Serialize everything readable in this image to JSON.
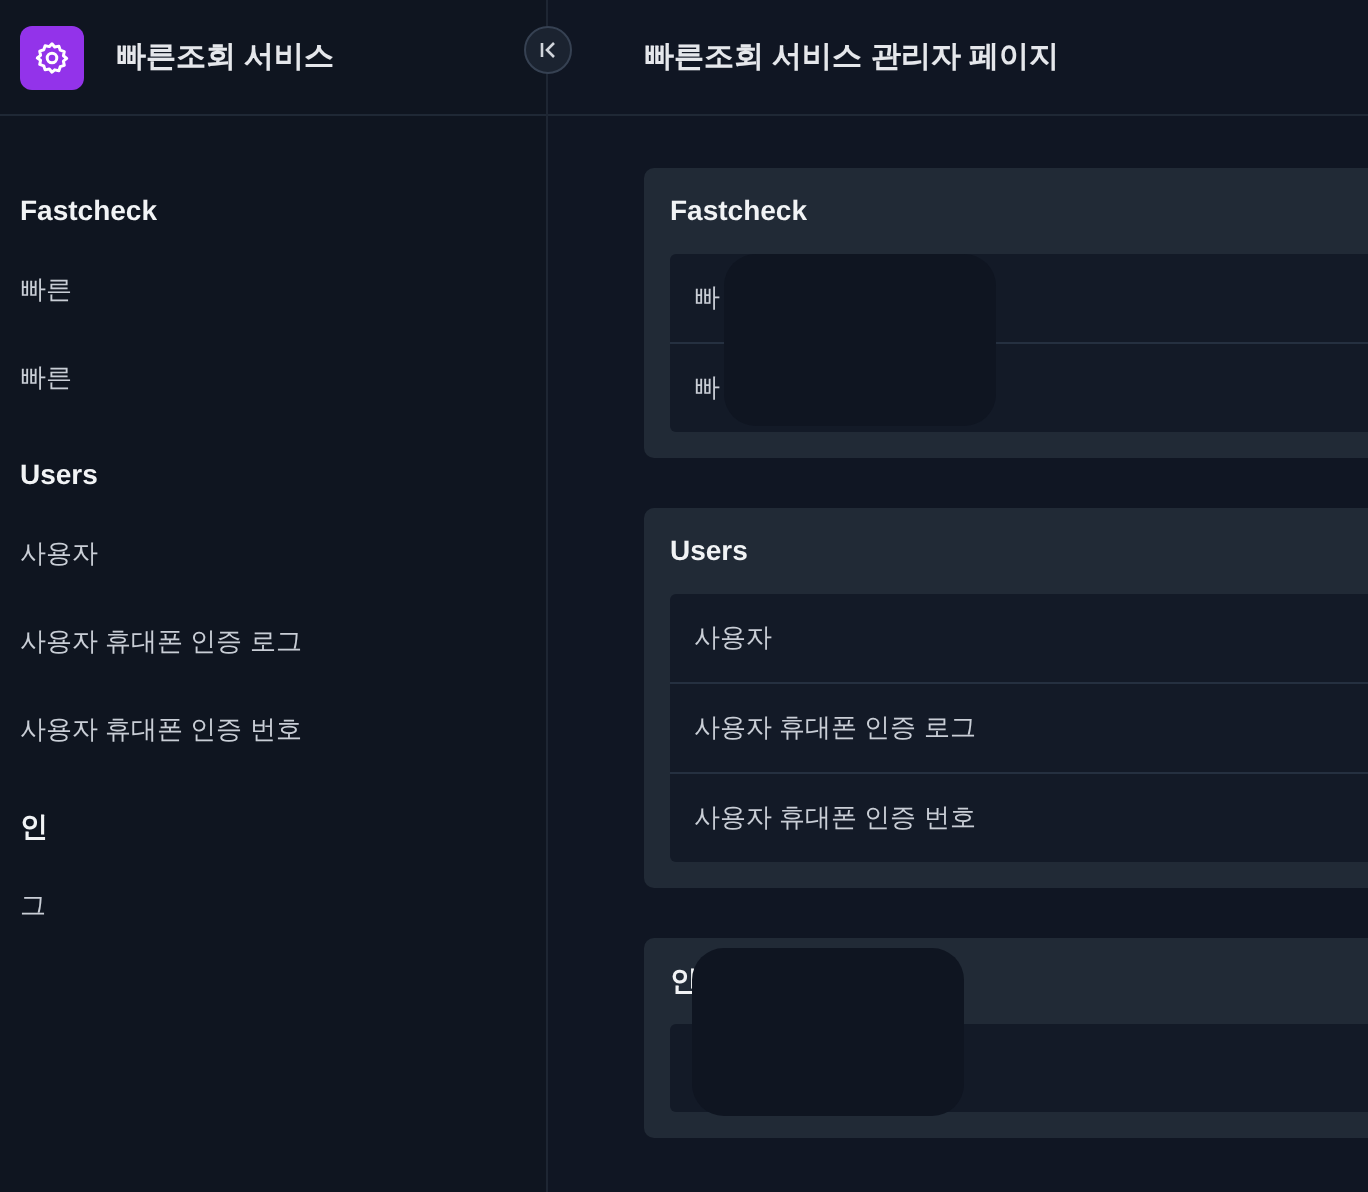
{
  "app": {
    "name": "빠른조회 서비스"
  },
  "page_title": "빠른조회 서비스 관리자 페이지",
  "sidebar": {
    "groups": [
      {
        "title": "Fastcheck",
        "items": [
          "빠른",
          "빠른"
        ]
      },
      {
        "title": "Users",
        "items": [
          "사용자",
          "사용자 휴대폰 인증 로그",
          "사용자 휴대폰 인증 번호"
        ]
      },
      {
        "title": "인",
        "items": [
          "그"
        ]
      }
    ]
  },
  "cards": [
    {
      "title": "Fastcheck",
      "items": [
        "빠",
        "빠"
      ],
      "redacted": true
    },
    {
      "title": "Users",
      "items": [
        "사용자",
        "사용자 휴대폰 인증 로그",
        "사용자 휴대폰 인증 번호"
      ],
      "redacted": false
    },
    {
      "title": "인",
      "redacted": true
    }
  ]
}
